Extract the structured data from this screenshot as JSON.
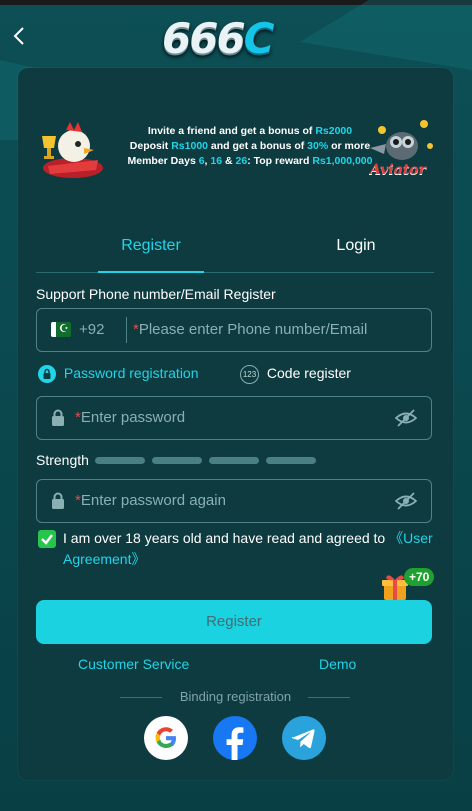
{
  "header": {
    "logo_text": "666",
    "logo_c": "C"
  },
  "banner": {
    "line1_a": "Invite a friend and get a bonus of ",
    "line1_b": "Rs2000",
    "line2_a": "Deposit ",
    "line2_b": "Rs1000",
    "line2_c": " and get a bonus of ",
    "line2_d": "30%",
    "line2_e": " or more",
    "line3_a": "Member Days ",
    "line3_b": "6",
    "line3_c": ", ",
    "line3_d": "16",
    "line3_e": " & ",
    "line3_f": "26",
    "line3_g": ": Top reward ",
    "line3_h": "Rs1,000,000",
    "right_logo": "Aviator"
  },
  "tabs": {
    "register": "Register",
    "login": "Login"
  },
  "form": {
    "section_label": "Support Phone number/Email Register",
    "country_code": "+92",
    "phone_placeholder": "Please enter Phone number/Email",
    "password_registration": "Password registration",
    "code_register": "Code register",
    "code_icon_text": "123",
    "password_placeholder": "Enter password",
    "strength_label": "Strength",
    "password_again_placeholder": "Enter password again",
    "agree_text": "I am over 18 years old and have read and agreed to ",
    "agree_link": "《User Agreement》",
    "gift_badge": "+70",
    "register_button": "Register"
  },
  "footer": {
    "customer_service": "Customer Service",
    "demo": "Demo",
    "binding": "Binding registration"
  },
  "colors": {
    "accent": "#21d4e8",
    "button": "#1ad2e0",
    "checkbox": "#26c54b",
    "card": "#0d3b40"
  }
}
